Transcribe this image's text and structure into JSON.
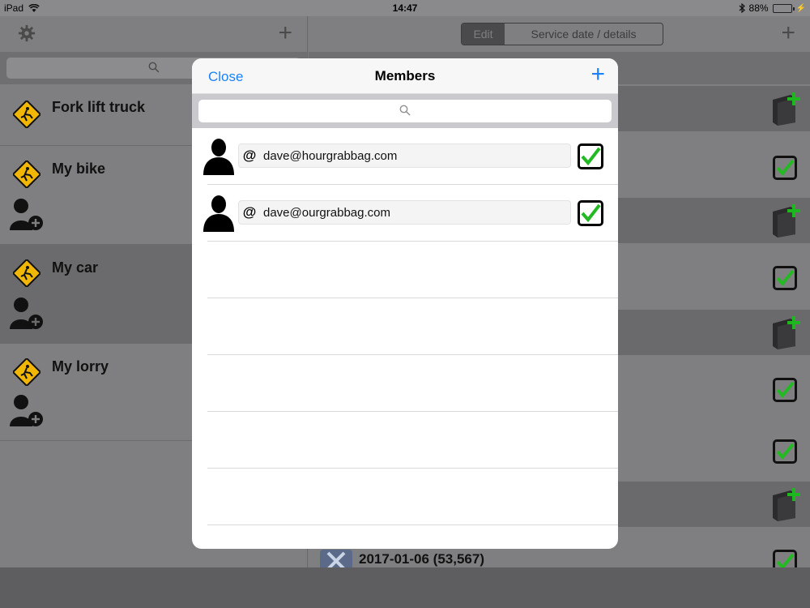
{
  "status_bar": {
    "device": "iPad",
    "time": "14:47",
    "battery_percent": "88%",
    "battery_level": 0.88
  },
  "master": {
    "settings_icon": "gear-icon",
    "add_icon": "plus-icon",
    "vehicles": [
      {
        "name": "Fork lift truck"
      },
      {
        "name": "My bike"
      },
      {
        "name": "My car"
      },
      {
        "name": "My lorry"
      }
    ]
  },
  "detail": {
    "segmented": {
      "edit_label": "Edit",
      "service_label": "Service date / details"
    },
    "last_entry": "2017-01-06 (53,567)"
  },
  "modal": {
    "close_label": "Close",
    "title": "Members",
    "add_icon": "plus-icon",
    "members": [
      {
        "at": "@",
        "email": "dave@hourgrabbag.com",
        "checked": true
      },
      {
        "at": "@",
        "email": "dave@ourgrabbag.com",
        "checked": true
      }
    ]
  },
  "colors": {
    "accent": "#1a82fb",
    "check_green": "#22b922",
    "warning_yellow": "#f2b705"
  }
}
